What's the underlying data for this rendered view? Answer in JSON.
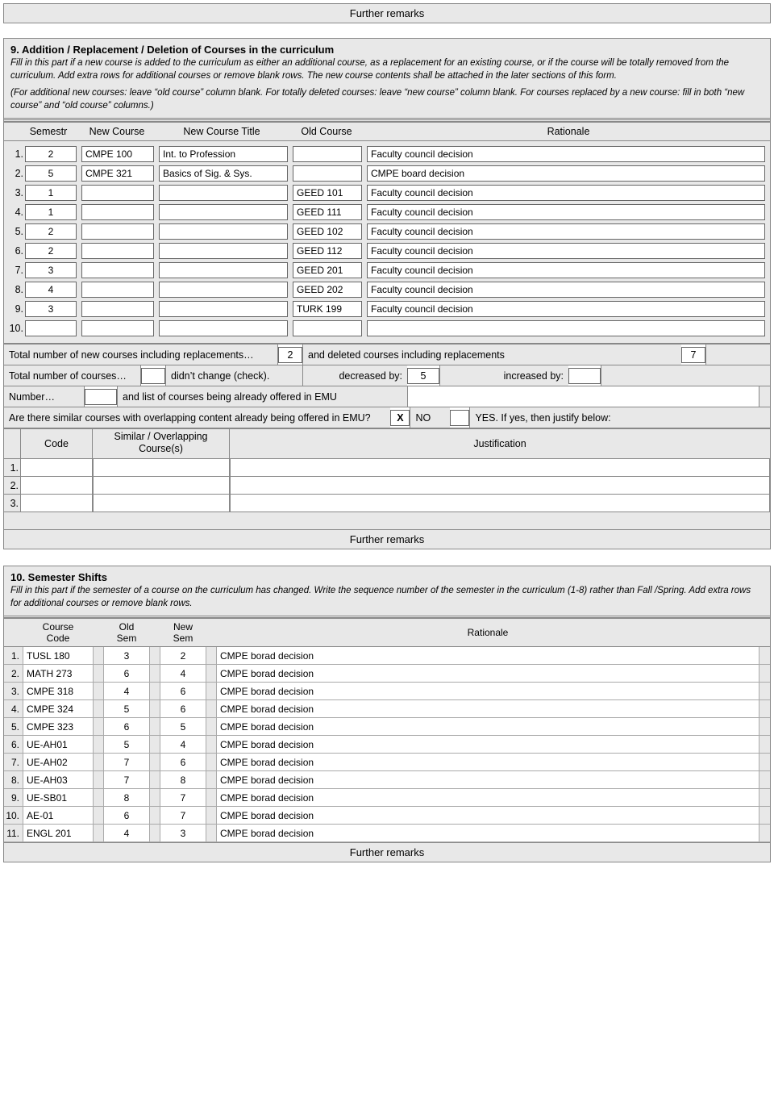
{
  "top_banner": "Further remarks",
  "section9": {
    "title": "9. Addition / Replacement / Deletion of Courses in the curriculum",
    "intro": "Fill in this part if a new course is added to the curriculum as either an additional course, as a replacement for an existing course, or if the course will be totally removed from the curriculum. Add extra rows for additional courses or remove blank rows. The new course contents shall be attached in the later sections of this form.",
    "note": "(For additional new courses: leave “old course” column blank. For totally deleted courses: leave “new course” column blank. For courses replaced by a new course: fill in both “new course” and “old course” columns.)",
    "headers": {
      "semestr": "Semestr",
      "new_course": "New Course",
      "new_course_title": "New Course Title",
      "old_course": "Old Course",
      "rationale": "Rationale"
    },
    "rows": [
      {
        "n": "1.",
        "sem": "2",
        "new": "CMPE 100",
        "title": "Int. to Profession",
        "old": "",
        "rat": "Faculty council decision"
      },
      {
        "n": "2.",
        "sem": "5",
        "new": "CMPE 321",
        "title": "Basics of Sig. & Sys.",
        "old": "",
        "rat": "CMPE board decision"
      },
      {
        "n": "3.",
        "sem": "1",
        "new": "",
        "title": "",
        "old": "GEED 101",
        "rat": "Faculty council decision"
      },
      {
        "n": "4.",
        "sem": "1",
        "new": "",
        "title": "",
        "old": "GEED 111",
        "rat": "Faculty council decision"
      },
      {
        "n": "5.",
        "sem": "2",
        "new": "",
        "title": "",
        "old": "GEED 102",
        "rat": "Faculty council decision"
      },
      {
        "n": "6.",
        "sem": "2",
        "new": "",
        "title": "",
        "old": "GEED 112",
        "rat": "Faculty council decision"
      },
      {
        "n": "7.",
        "sem": "3",
        "new": "",
        "title": "",
        "old": "GEED 201",
        "rat": "Faculty council decision"
      },
      {
        "n": "8.",
        "sem": "4",
        "new": "",
        "title": "",
        "old": "GEED 202",
        "rat": "Faculty council decision"
      },
      {
        "n": "9.",
        "sem": "3",
        "new": "",
        "title": "",
        "old": "TURK 199",
        "rat": "Faculty council decision"
      },
      {
        "n": "10.",
        "sem": "",
        "new": "",
        "title": "",
        "old": "",
        "rat": ""
      }
    ],
    "sum": {
      "ln1a": "Total number of new courses including replacements…",
      "ln1v": "2",
      "ln1b": "and deleted courses including replacements",
      "ln1v2": "7",
      "ln2a": "Total number of courses…",
      "ln2b": "didn’t change (check).",
      "ln2c": "decreased by:",
      "ln2cv": "5",
      "ln2d": "increased by:",
      "ln3a": "Number…",
      "ln3b": "and list of courses being already offered in EMU",
      "q": "Are there similar courses with overlapping content already being offered in EMU?",
      "x": "X",
      "no": "NO",
      "yes": "YES. If yes, then justify below:"
    },
    "jheaders": {
      "code": "Code",
      "overlap": "Similar / Overlapping Course(s)",
      "justification": "Justification"
    },
    "jrows": [
      "1.",
      "2.",
      "3."
    ],
    "further": "Further remarks"
  },
  "section10": {
    "title": "10. Semester Shifts",
    "intro": "Fill in this part if the semester of a course on the curriculum has changed. Write the sequence number of the semester in the curriculum (1-8) rather than Fall /Spring. Add extra rows for additional courses or remove blank rows.",
    "headers": {
      "code": "Course Code",
      "old": "Old Sem",
      "new": "New Sem",
      "rat": "Rationale"
    },
    "rows": [
      {
        "n": "1.",
        "code": "TUSL 180",
        "old": "3",
        "new": "2",
        "rat": "CMPE borad decision"
      },
      {
        "n": "2.",
        "code": "MATH 273",
        "old": "6",
        "new": "4",
        "rat": "CMPE borad decision"
      },
      {
        "n": "3.",
        "code": "CMPE 318",
        "old": "4",
        "new": "6",
        "rat": "CMPE borad decision"
      },
      {
        "n": "4.",
        "code": "CMPE 324",
        "old": "5",
        "new": "6",
        "rat": "CMPE borad decision"
      },
      {
        "n": "5.",
        "code": "CMPE 323",
        "old": "6",
        "new": "5",
        "rat": "CMPE borad decision"
      },
      {
        "n": "6.",
        "code": "UE-AH01",
        "old": "5",
        "new": "4",
        "rat": "CMPE borad decision"
      },
      {
        "n": "7.",
        "code": "UE-AH02",
        "old": "7",
        "new": "6",
        "rat": "CMPE borad decision"
      },
      {
        "n": "8.",
        "code": "UE-AH03",
        "old": "7",
        "new": "8",
        "rat": "CMPE borad decision"
      },
      {
        "n": "9.",
        "code": "UE-SB01",
        "old": "8",
        "new": "7",
        "rat": "CMPE borad decision"
      },
      {
        "n": "10.",
        "code": "AE-01",
        "old": "6",
        "new": "7",
        "rat": "CMPE borad decision"
      },
      {
        "n": "11.",
        "code": "ENGL 201",
        "old": "4",
        "new": "3",
        "rat": "CMPE borad decision"
      }
    ],
    "further": "Further remarks"
  }
}
